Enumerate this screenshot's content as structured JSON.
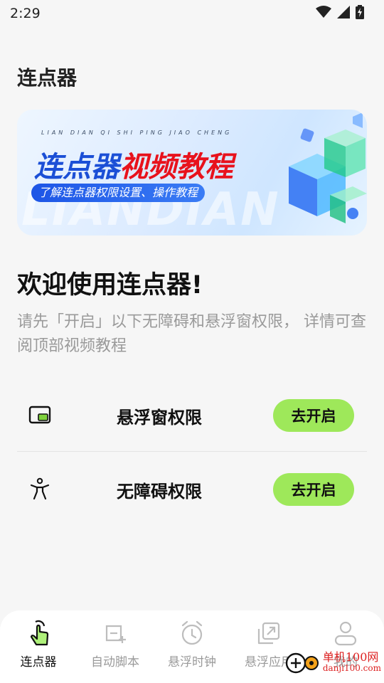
{
  "status": {
    "time": "2:29"
  },
  "page": {
    "title": "连点器"
  },
  "banner": {
    "pinyin": "LIAN DIAN QI SHI PING JIAO CHENG",
    "title_blue": "连点器",
    "title_red": "视频教程",
    "subtitle": "了解连点器权限设置、操作教程",
    "watermark": "LIANDIAN"
  },
  "welcome": {
    "title": "欢迎使用连点器!",
    "description": "请先「开启」以下无障碍和悬浮窗权限， 详情可查阅顶部视频教程"
  },
  "permissions": [
    {
      "label": "悬浮窗权限",
      "button": "去开启",
      "icon": "floating-window-icon"
    },
    {
      "label": "无障碍权限",
      "button": "去开启",
      "icon": "accessibility-icon"
    }
  ],
  "nav": [
    {
      "label": "连点器",
      "icon": "tap-icon",
      "active": true
    },
    {
      "label": "自动脚本",
      "icon": "script-add-icon",
      "active": false
    },
    {
      "label": "悬浮时钟",
      "icon": "alarm-clock-icon",
      "active": false
    },
    {
      "label": "悬浮应用",
      "icon": "floating-app-icon",
      "active": false
    },
    {
      "label": "我的",
      "icon": "user-icon",
      "active": false
    }
  ],
  "site_watermark": {
    "text": "单机100网",
    "url": "danji100.com"
  },
  "colors": {
    "accent_green": "#9ee85a",
    "banner_blue": "#1b4fd6",
    "banner_red": "#e8121c"
  }
}
